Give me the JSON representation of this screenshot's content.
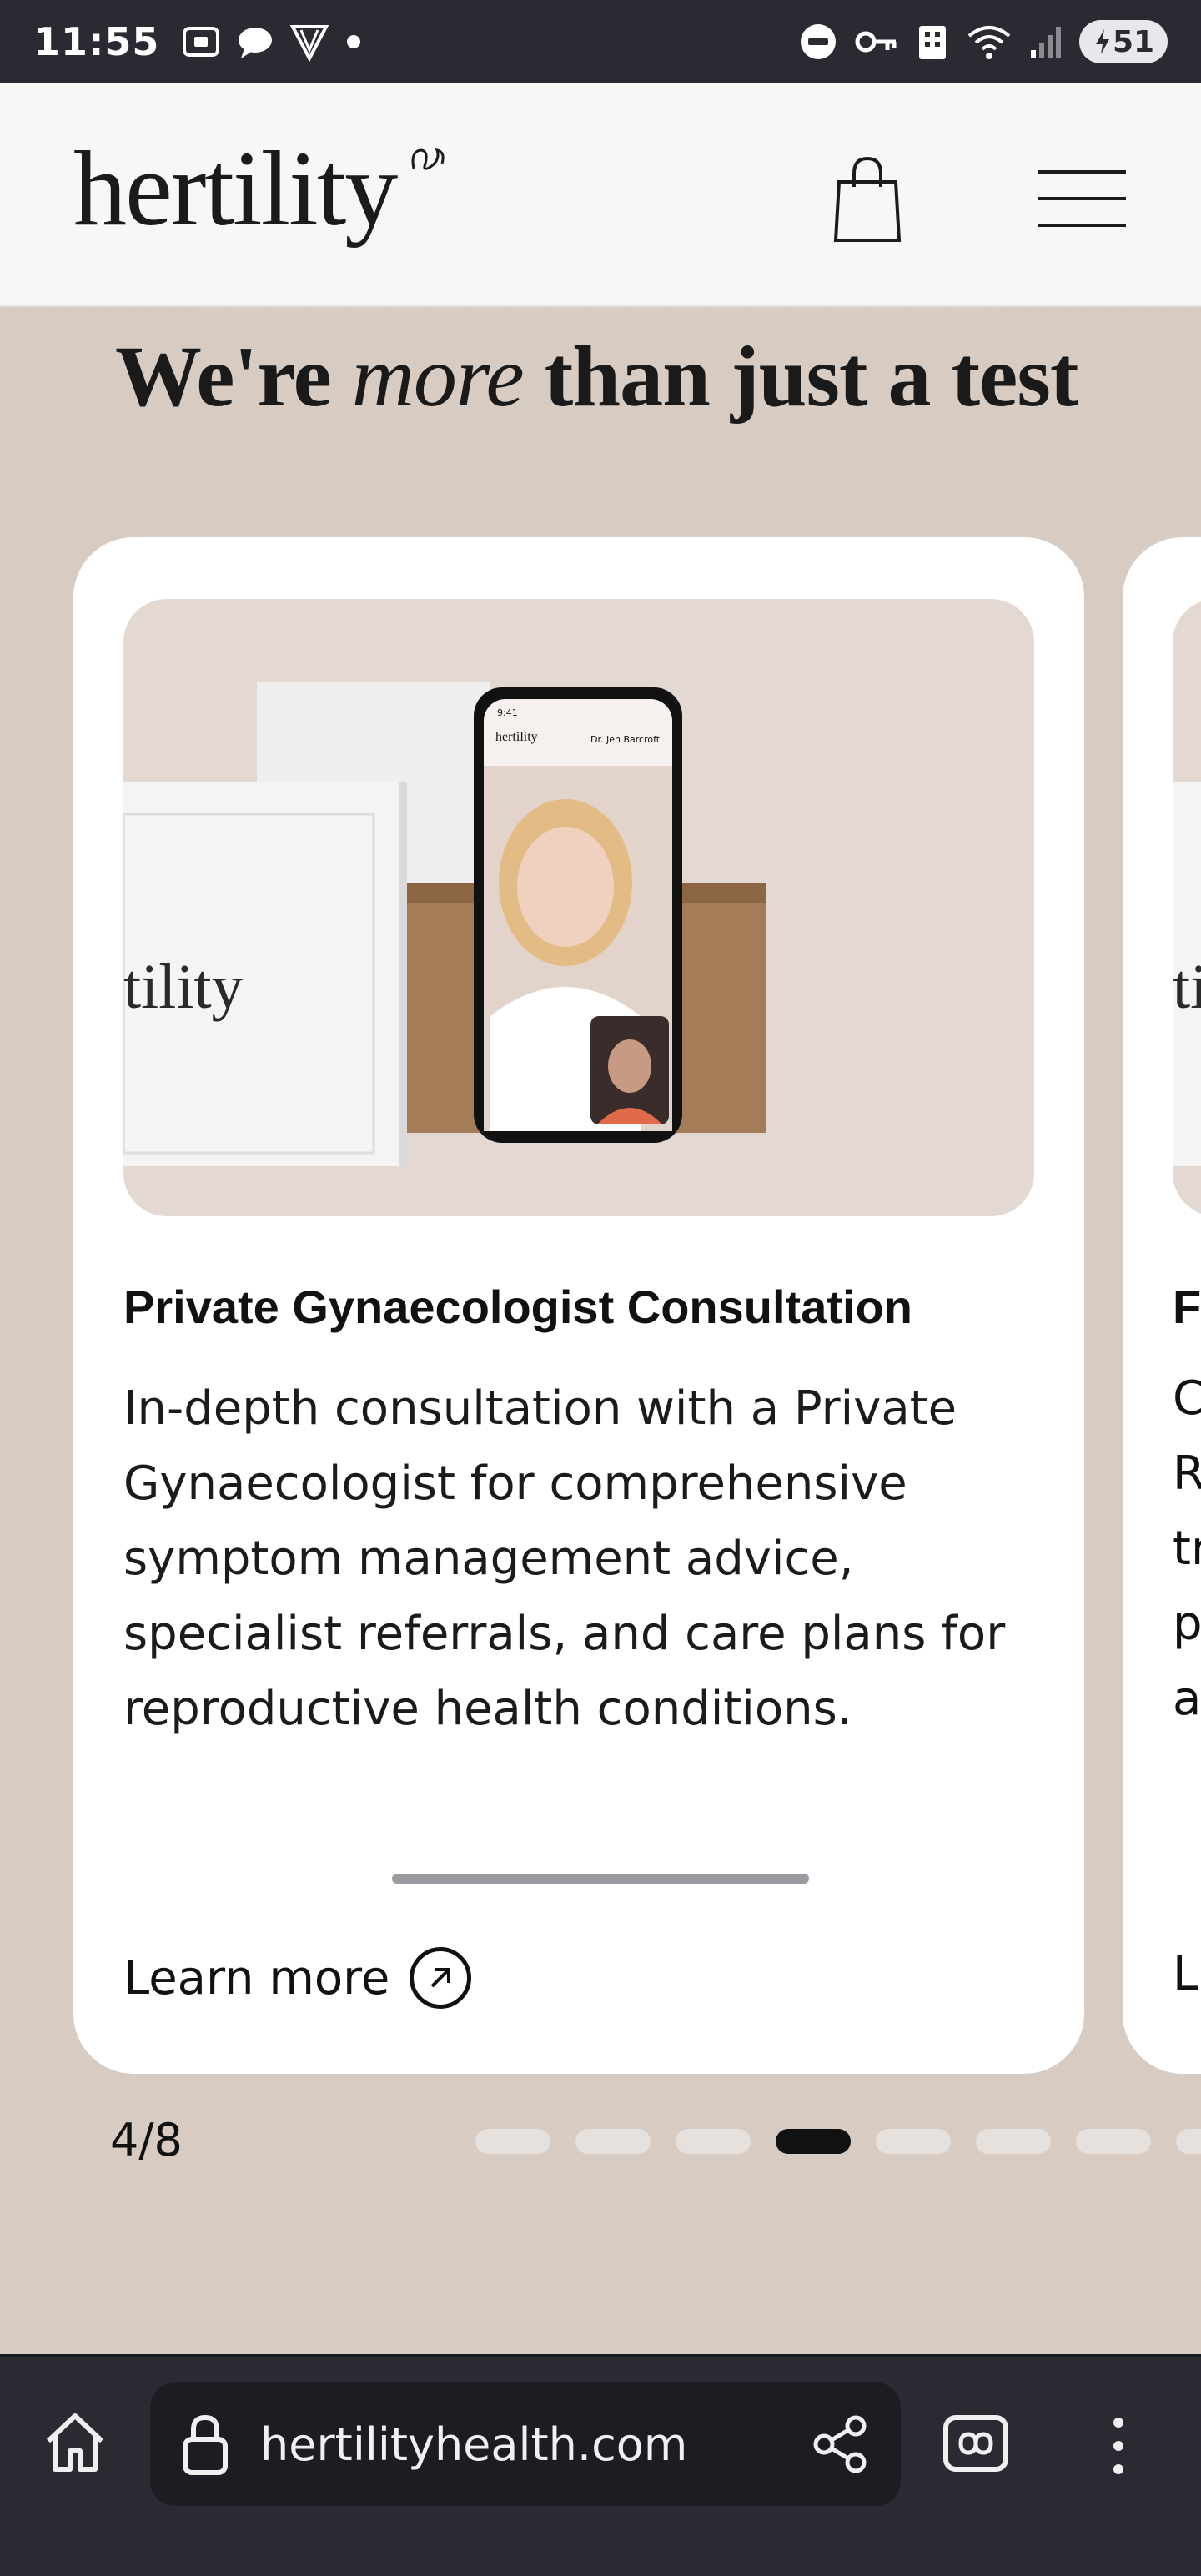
{
  "status_bar": {
    "time": "11:55",
    "battery": "51",
    "icons_left": [
      "screenshot-icon",
      "chat-icon",
      "vpn-shield-icon",
      "dot-icon"
    ],
    "icons_right": [
      "do-not-disturb-icon",
      "key-icon",
      "building-icon",
      "wifi-icon",
      "signal-icon",
      "battery-icon"
    ]
  },
  "header": {
    "logo_text": "hertility",
    "cart_icon": "shopping-bag-icon",
    "menu_icon": "hamburger-menu-icon"
  },
  "section": {
    "headline_pre": "We're ",
    "headline_em": "more",
    "headline_post": " than just a test"
  },
  "card": {
    "title": "Private Gynaecologist Consultation",
    "description": "In-depth consultation with a Private Gynaecologist for comprehensive symptom management advice, specialist referrals, and care plans for reproductive health conditions.",
    "link_label": "Learn more",
    "image_box_text": "tility",
    "phone_brand": "hertility",
    "phone_doctor": "Dr. Jen Barcroft",
    "phone_time": "9:41"
  },
  "next_card": {
    "title_initial": "F",
    "desc_initials": [
      "C",
      "R",
      "tr",
      "p",
      "a"
    ],
    "link_initial": "L",
    "image_text": "ti"
  },
  "pagination": {
    "current": "4/8",
    "total_dots": 8,
    "active_index": 3
  },
  "browser": {
    "url": "hertilityhealth.com",
    "icons": [
      "home-icon",
      "lock-icon",
      "share-icon",
      "tab-switcher-icon",
      "more-vert-icon"
    ]
  }
}
